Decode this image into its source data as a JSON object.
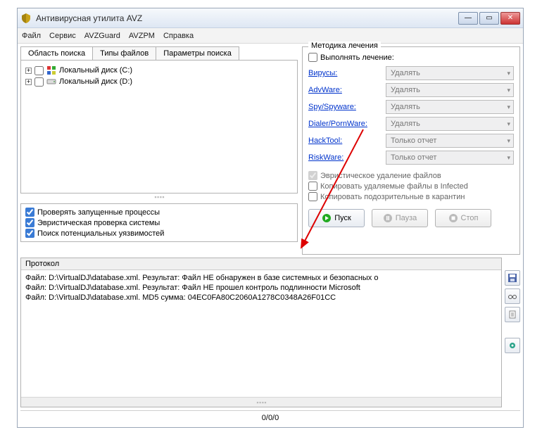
{
  "window": {
    "title": "Антивирусная утилита AVZ"
  },
  "menu": {
    "file": "Файл",
    "service": "Сервис",
    "avzguard": "AVZGuard",
    "avzpm": "AVZPM",
    "help": "Справка"
  },
  "tabs": {
    "scope": "Область поиска",
    "types": "Типы файлов",
    "params": "Параметры поиска"
  },
  "drives": [
    {
      "label": "Локальный диск (C:)"
    },
    {
      "label": "Локальный диск (D:)"
    }
  ],
  "opts": {
    "processes": "Проверять запущенные процессы",
    "heuristic": "Эвристическая проверка системы",
    "vuln": "Поиск потенциальных уязвимостей"
  },
  "treat": {
    "legend": "Методика лечения",
    "enable": "Выполнять лечение:",
    "rows": [
      {
        "label": "Вирусы:",
        "value": "Удалять"
      },
      {
        "label": "AdvWare:",
        "value": "Удалять"
      },
      {
        "label": "Spy/Spyware:",
        "value": "Удалять"
      },
      {
        "label": "Dialer/PornWare:",
        "value": "Удалять"
      },
      {
        "label": "HackTool:",
        "value": "Только отчет"
      },
      {
        "label": "RiskWare:",
        "value": "Только отчет"
      }
    ],
    "heur_del": "Эвристическое удаление файлов",
    "copy_infected": "Копировать удаляемые файлы в  Infected",
    "copy_quarantine": "Копировать подозрительные в  карантин"
  },
  "buttons": {
    "start": "Пуск",
    "pause": "Пауза",
    "stop": "Стоп"
  },
  "proto": {
    "title": "Протокол",
    "lines": [
      "Файл: D:\\VirtualDJ\\database.xml. Результат: Файл НЕ обнаружен в базе системных и безопасных о",
      "Файл: D:\\VirtualDJ\\database.xml. Результат: Файл НЕ прошел контроль подлинности Microsoft",
      "Файл: D:\\VirtualDJ\\database.xml. MD5 сумма: 04EC0FA80C2060A1278C0348A26F01CC"
    ]
  },
  "status": {
    "counter": "0/0/0"
  }
}
